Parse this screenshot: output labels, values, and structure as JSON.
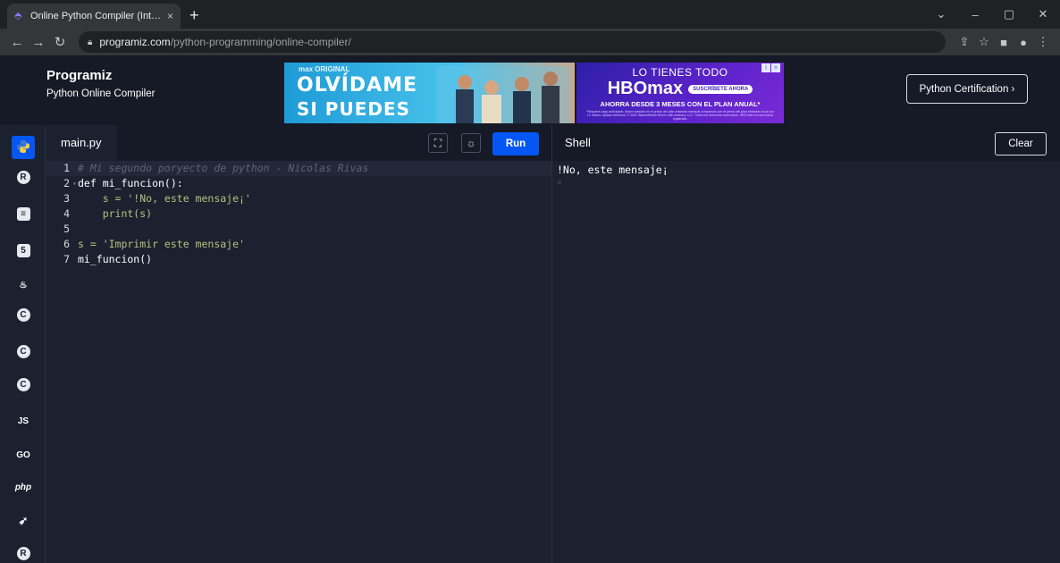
{
  "browser": {
    "tab_title": "Online Python Compiler (Interpre",
    "tab_close": "×",
    "new_tab": "+",
    "url_host": "programiz.com",
    "url_path": "/python-programming/online-compiler/",
    "window_controls": [
      "⌄",
      "–",
      "▢",
      "✕"
    ]
  },
  "header": {
    "brand": "Programiz",
    "subtitle": "Python Online Compiler",
    "certification_button": "Python Certification ›"
  },
  "ads": {
    "ad1": {
      "tag": "max ORIGINAL",
      "line1": "OLVÍDAME",
      "line2": "SI PUEDES"
    },
    "ad2": {
      "line1": "LO TIENES TODO",
      "logo": "HBOmax",
      "pill": "SUSCRÍBETE AHORA",
      "line3": "AHORRA DESDE 3 MESES CON EL PLAN ANUAL*",
      "fine_print": "*Requiere pago anticipado. Ahorro basado en el precio del plan estándar mensual comparado con el precio del plan estándar anual por 12 meses. Aplican términos. © 2022 WarnerMedia Direct Latin America, LLC. Todos los derechos reservados. HBO Max es una marca registrada."
    }
  },
  "sidebar": {
    "items": [
      {
        "name": "python",
        "glyph": "",
        "active": true
      },
      {
        "name": "r",
        "glyph": "R"
      },
      {
        "name": "sql",
        "glyph": "≡"
      },
      {
        "name": "html",
        "glyph": "5"
      },
      {
        "name": "java",
        "glyph": "♨"
      },
      {
        "name": "c",
        "glyph": "C"
      },
      {
        "name": "cpp",
        "glyph": "C"
      },
      {
        "name": "csharp",
        "glyph": "C"
      },
      {
        "name": "javascript",
        "glyph": "JS"
      },
      {
        "name": "go",
        "glyph": "GO"
      },
      {
        "name": "php",
        "glyph": "php"
      },
      {
        "name": "swift",
        "glyph": "➶"
      },
      {
        "name": "rust",
        "glyph": "R"
      }
    ]
  },
  "editor": {
    "filename": "main.py",
    "run_label": "Run",
    "fullscreen_icon": "⛶",
    "theme_icon": "☼",
    "lines": [
      {
        "n": "1",
        "code": "# Mi segundo poryecto de python - Nicolas Rivas"
      },
      {
        "n": "2",
        "code": "def mi_funcion():"
      },
      {
        "n": "3",
        "code": "    s = '!No, este mensaje¡'"
      },
      {
        "n": "4",
        "code": "    print(s)"
      },
      {
        "n": "5",
        "code": ""
      },
      {
        "n": "6",
        "code": "s = 'Imprimir este mensaje'"
      },
      {
        "n": "7",
        "code": "mi_funcion()"
      }
    ]
  },
  "shell": {
    "title": "Shell",
    "clear_label": "Clear",
    "output": "!No, este mensaje¡",
    "prompt": ">"
  }
}
